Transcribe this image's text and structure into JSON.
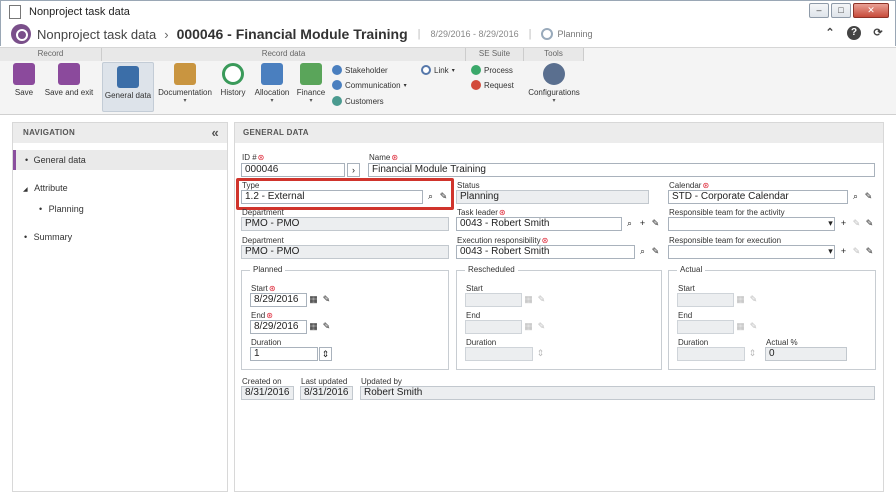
{
  "window": {
    "title": "Nonproject task data",
    "controls": {
      "minimize": "–",
      "maximize": "□",
      "close": "✕"
    }
  },
  "header": {
    "breadcrumb_root": "Nonproject task data",
    "breadcrumb_sep": "›",
    "record_title": "000046 - Financial Module Training",
    "pipe": "|",
    "dates": "8/29/2016 - 8/29/2016",
    "status": "Planning",
    "btn_up": "⌃",
    "btn_help": "?",
    "btn_refresh": "⟳"
  },
  "ribbon": {
    "groups": {
      "record": "Record",
      "record_data": "Record data",
      "se_suite": "SE Suite",
      "tools": "Tools"
    },
    "buttons": {
      "save": "Save",
      "save_exit": "Save and exit",
      "general_data": "General data",
      "documentation": "Documentation",
      "history": "History",
      "allocation": "Allocation",
      "finance": "Finance",
      "stakeholder": "Stakeholder",
      "communication": "Communication",
      "customers": "Customers",
      "link": "Link",
      "process": "Process",
      "request": "Request",
      "configurations": "Configurations"
    },
    "caret": "▾"
  },
  "navigation": {
    "header": "NAVIGATION",
    "collapse": "«",
    "items": [
      {
        "label": "General data"
      },
      {
        "label": "Attribute"
      },
      {
        "label": "Planning"
      },
      {
        "label": "Summary"
      }
    ],
    "bullet": "•",
    "expander": "◢"
  },
  "general": {
    "header": "GENERAL DATA",
    "id_label": "ID #",
    "id_value": "000046",
    "name_label": "Name",
    "name_value": "Financial Module Training",
    "type_label": "Type",
    "type_value": "1.2 - External",
    "status_label": "Status",
    "status_value": "Planning",
    "calendar_label": "Calendar",
    "calendar_value": "STD - Corporate Calendar",
    "department1_label": "Department",
    "department1_value": "PMO - PMO",
    "task_leader_label": "Task leader",
    "task_leader_value": "0043 - Robert Smith",
    "resp_team_activity_label": "Responsible team for the activity",
    "resp_team_activity_value": "",
    "department2_label": "Department",
    "department2_value": "PMO - PMO",
    "exec_resp_label": "Execution responsibility",
    "exec_resp_value": "0043 - Robert Smith",
    "resp_team_exec_label": "Responsible team for execution",
    "resp_team_exec_value": "",
    "required_mark": "⊛"
  },
  "planned": {
    "title": "Planned",
    "start_label": "Start",
    "start_value": "8/29/2016",
    "end_label": "End",
    "end_value": "8/29/2016",
    "duration_label": "Duration",
    "duration_value": "1"
  },
  "rescheduled": {
    "title": "Rescheduled",
    "start_label": "Start",
    "end_label": "End",
    "duration_label": "Duration"
  },
  "actual": {
    "title": "Actual",
    "start_label": "Start",
    "end_label": "End",
    "duration_label": "Duration",
    "pct_label": "Actual %",
    "pct_value": "0"
  },
  "audit": {
    "created_label": "Created on",
    "created_value": "8/31/2016",
    "updated_label": "Last updated",
    "updated_value": "8/31/2016",
    "updated_by_label": "Updated by",
    "updated_by_value": "Robert Smith"
  },
  "icons": {
    "search": "⌕",
    "clear": "✎",
    "add": "+",
    "dropdown": "▾",
    "arrow": "›",
    "calendar": "▦",
    "spin": "⇕"
  }
}
